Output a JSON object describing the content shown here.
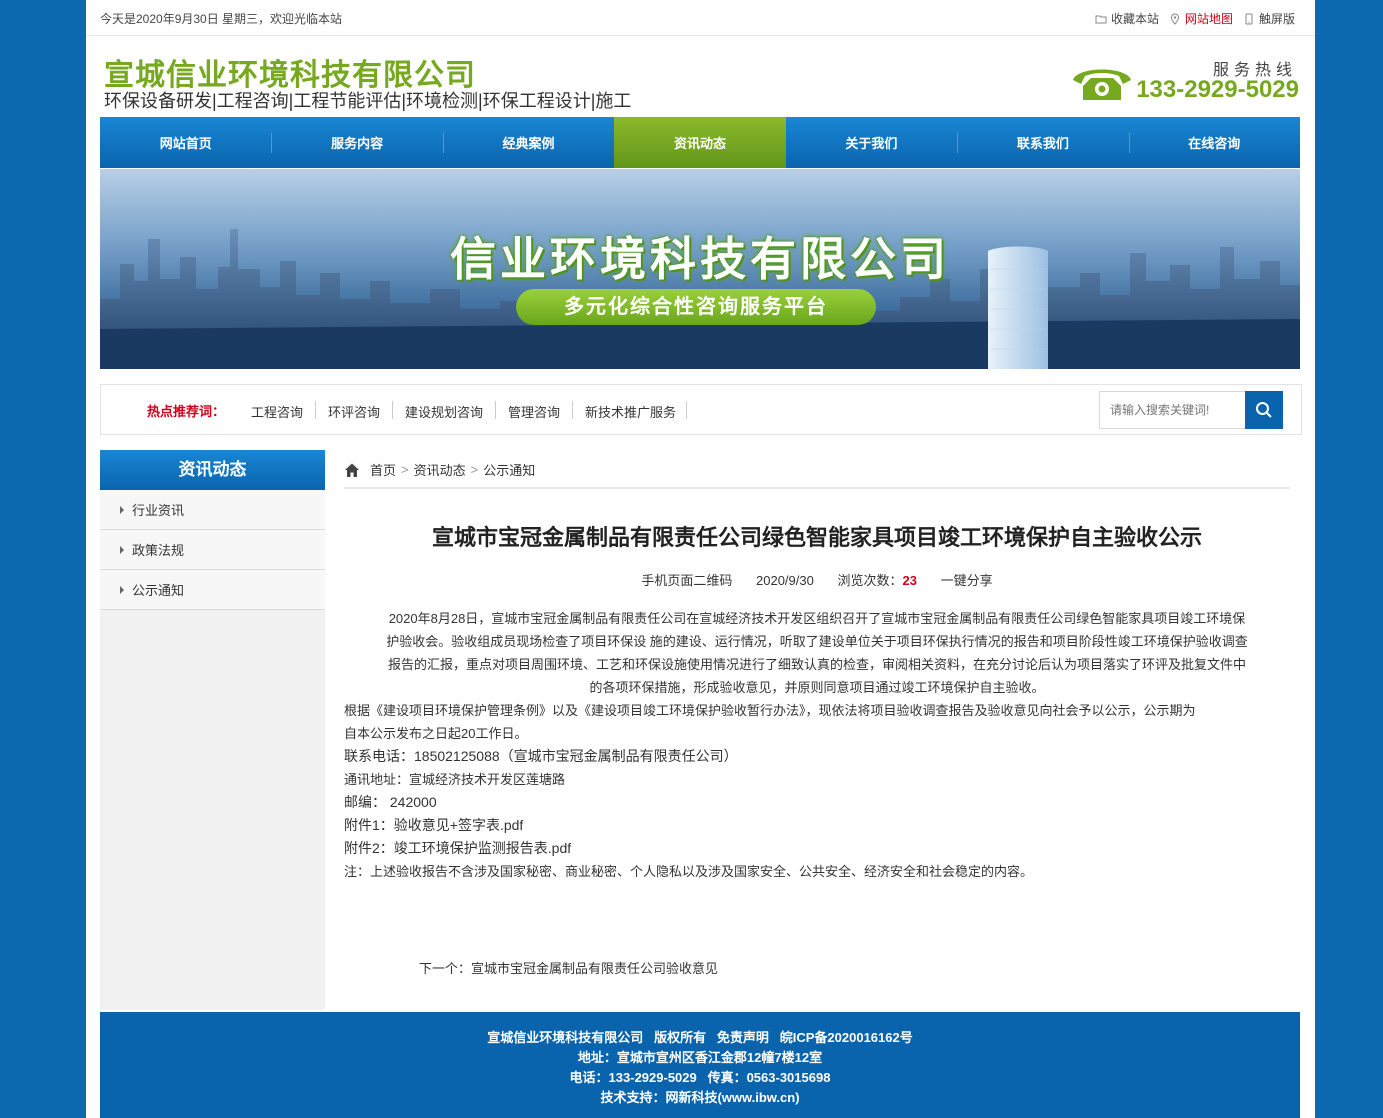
{
  "topbar": {
    "welcome": "今天是2020年9月30日 星期三，欢迎光临本站",
    "favorite": "收藏本站",
    "sitemap": "网站地图",
    "touch": "触屏版"
  },
  "header": {
    "company": "宣城信业环境科技有限公司",
    "services": "环保设备研发|工程咨询|工程节能评估|环境检测|环保工程设计|施工",
    "hotline_label": "服务热线",
    "hotline_number": "133-2929-5029"
  },
  "nav": [
    "网站首页",
    "服务内容",
    "经典案例",
    "资讯动态",
    "关于我们",
    "联系我们",
    "在线咨询"
  ],
  "nav_active": "资讯动态",
  "banner": {
    "title": "信业环境科技有限公司",
    "subtitle": "多元化综合性咨询服务平台"
  },
  "hot": {
    "label": "热点推荐词：",
    "keywords": [
      "工程咨询",
      "环评咨询",
      "建设规划咨询",
      "管理咨询",
      "新技术推广服务"
    ],
    "search_placeholder": "请输入搜索关键词!"
  },
  "sidebar": {
    "title": "资讯动态",
    "items": [
      "行业资讯",
      "政策法规",
      "公示通知"
    ]
  },
  "breadcrumb": {
    "home": "首页",
    "section": "资讯动态",
    "current": "公示通知"
  },
  "article": {
    "title": "宣城市宝冠金属制品有限责任公司绿色智能家具项目竣工环境保护自主验收公示",
    "qr": "手机页面二维码",
    "date": "2020/9/30",
    "views_label": "浏览次数：",
    "views": "23",
    "share": "一键分享",
    "para1_lines": [
      "2020年8月28日，宣城市宝冠金属制品有限责任公司在宣城经济技术开发区组织召开了宣城市宝冠金属制品有限责任公司绿色智能家具项目竣工环境保",
      "护验收会。验收组成员现场检查了项目环保设 施的建设、运行情况，听取了建设单位关于项目环保执行情况的报告和项目阶段性竣工环境保护验收调查",
      "报告的汇报，重点对项目周围环境、工艺和环保设施使用情况进行了细致认真的检查，审阅相关资料，在充分讨论后认为项目落实了环评及批复文件中",
      "的各项环保措施，形成验收意见，并原则同意项目通过竣工环境保护自主验收。"
    ],
    "para2_lines": [
      "根据《建设项目环境保护管理条例》以及《建设项目竣工环境保护验收暂行办法》，现依法将项目验收调查报告及验收意见向社会予以公示，公示期为",
      "自本公示发布之日起20工作日。"
    ],
    "contact": "联系电话：18502125088（宣城市宝冠金属制品有限责任公司）",
    "address": "通讯地址：宣城经济技术开发区莲塘路",
    "postcode": "邮编： 242000",
    "attach1": "附件1：验收意见+签字表.pdf",
    "attach2": "附件2：竣工环境保护监测报告表.pdf",
    "note": "注：上述验收报告不含涉及国家秘密、商业秘密、个人隐私以及涉及国家安全、公共安全、经济安全和社会稳定的内容。",
    "next": "下一个：宣城市宝冠金属制品有限责任公司验收意见"
  },
  "footer": {
    "line1": "宣城信业环境科技有限公司   版权所有   免责声明   皖ICP备2020016162号",
    "line2": "地址：宣城市宣州区香江金郡12幢7楼12室",
    "line3": "电话：133-2929-5029   传真：0563-3015698",
    "line4": "技术支持：网新科技(www.ibw.cn)"
  },
  "colors": {
    "background": "#0e6ab0",
    "brand_green": "#76a91f",
    "nav_blue": "#0a64ad",
    "accent_red": "#d0021b"
  }
}
